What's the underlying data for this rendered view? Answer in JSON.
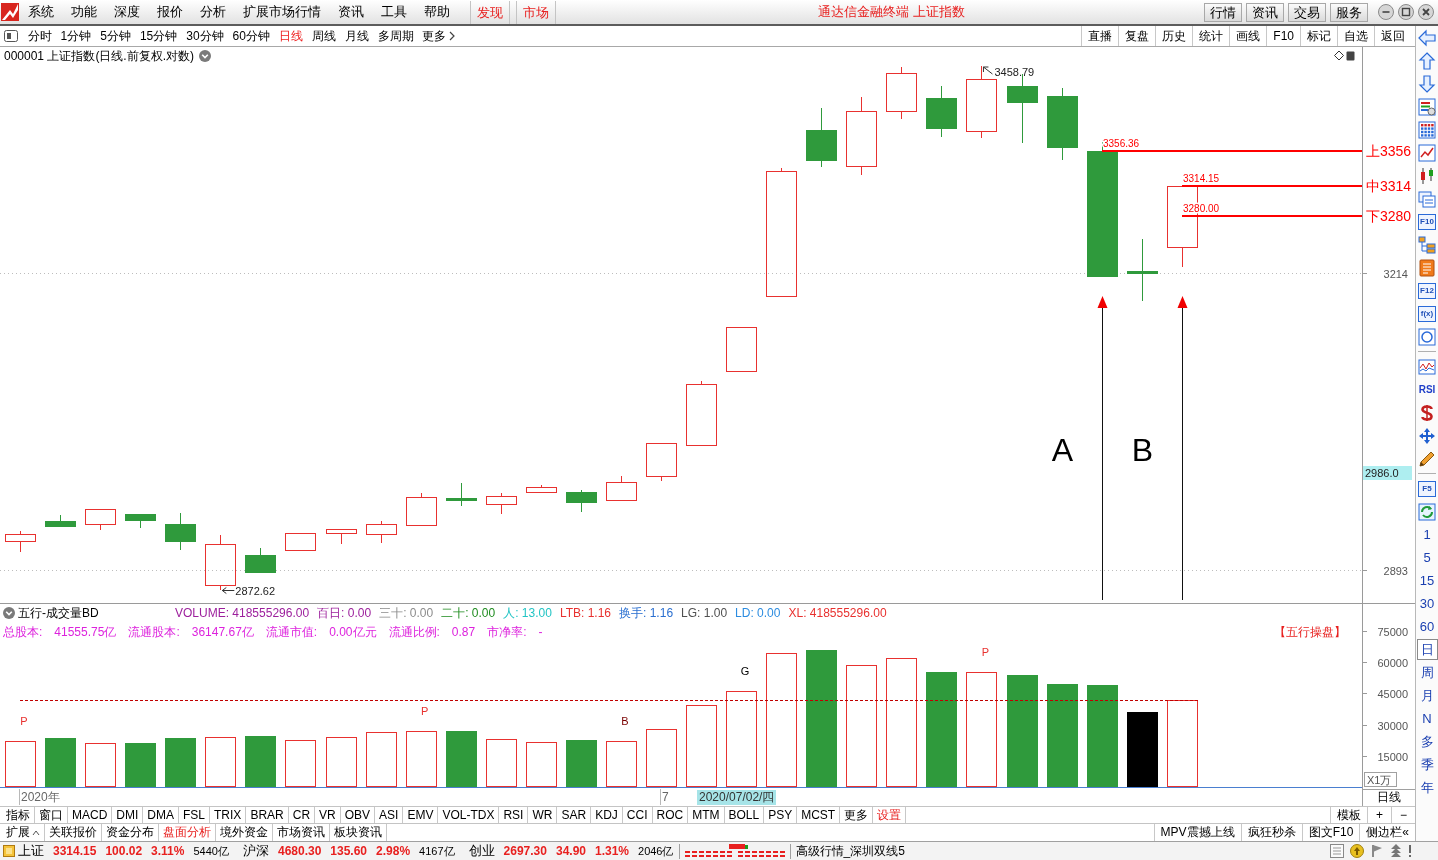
{
  "menu_bar": {
    "items": [
      "系统",
      "功能",
      "深度",
      "报价",
      "分析",
      "扩展市场行情",
      "资讯",
      "工具",
      "帮助"
    ],
    "tabs": [
      "发现",
      "市场"
    ],
    "title": "通达信金融终端 上证指数",
    "buttons": [
      "行情",
      "资讯",
      "交易",
      "服务"
    ]
  },
  "period_bar": {
    "periods": [
      {
        "label": "分时",
        "selected": false
      },
      {
        "label": "1分钟",
        "selected": false
      },
      {
        "label": "5分钟",
        "selected": false
      },
      {
        "label": "15分钟",
        "selected": false
      },
      {
        "label": "30分钟",
        "selected": false
      },
      {
        "label": "60分钟",
        "selected": false
      },
      {
        "label": "日线",
        "selected": true
      },
      {
        "label": "周线",
        "selected": false
      },
      {
        "label": "月线",
        "selected": false
      },
      {
        "label": "多周期",
        "selected": false
      }
    ],
    "more": "更多",
    "tools": [
      "直播",
      "复盘",
      "历史",
      "统计",
      "画线",
      "F10",
      "标记",
      "自选",
      "返回"
    ]
  },
  "price_pane": {
    "title": "000001 上证指数(日线.前复权.对数)",
    "high_label": "3458.79",
    "low_label": "2872.62",
    "level_values": [
      "3356.36",
      "3314.15",
      "3280.00"
    ],
    "arrow_labels": [
      "A",
      "B"
    ],
    "readout": "2986.0",
    "chart_data": [
      {
        "type": "candlestick",
        "log": true,
        "ylim": [
          2859.3,
          3482.0
        ],
        "yticks": [
          2893,
          3214
        ],
        "tick_labels": "y",
        "grid": true,
        "ohlc": [
          [
            2922.9,
            2933.3,
            2911.5,
            2930.2
          ],
          [
            2943.7,
            2949.9,
            2936.4,
            2938.5
          ],
          [
            2940.6,
            2956.2,
            2934.3,
            2956.2
          ],
          [
            2950.9,
            2950.9,
            2936.4,
            2944.7
          ],
          [
            2940.6,
            2951.9,
            2913.5,
            2922.9
          ],
          [
            2877.6,
            2929.1,
            2872.62,
            2919.7
          ],
          [
            2908.4,
            2915.6,
            2891.0,
            2891.0
          ],
          [
            2913.5,
            2931.2,
            2911.5,
            2931.2
          ],
          [
            2931.2,
            2936.4,
            2919.7,
            2935.4
          ],
          [
            2930.2,
            2943.7,
            2920.8,
            2940.6
          ],
          [
            2939.5,
            2972.9,
            2937.4,
            2968.7
          ],
          [
            2967.7,
            2983.5,
            2959.3,
            2965.6
          ],
          [
            2961.4,
            2972.9,
            2950.9,
            2969.8
          ],
          [
            2974.0,
            2981.4,
            2971.9,
            2979.3
          ],
          [
            2974.0,
            2976.1,
            2953.0,
            2963.5
          ],
          [
            2965.6,
            2990.9,
            2965.6,
            2984.6
          ],
          [
            2990.9,
            3026.1,
            2985.6,
            3025.98
          ],
          [
            3024.0,
            3093.4,
            3021.9,
            3090.57
          ],
          [
            3104.4,
            3153.1,
            3103.3,
            3152.81
          ],
          [
            3188.0,
            3335.8,
            3188.0,
            3332.88
          ],
          [
            3381.1,
            3407.5,
            3337.0,
            3345.34
          ],
          [
            3338.2,
            3420.8,
            3327.6,
            3403.44
          ],
          [
            3403.9,
            3457.4,
            3394.3,
            3450.59
          ],
          [
            3419.6,
            3434.2,
            3372.7,
            3383.32
          ],
          [
            3379.9,
            3458.79,
            3371.5,
            3443.29
          ],
          [
            3434.2,
            3448.8,
            3365.5,
            3414.62
          ],
          [
            3422.0,
            3431.8,
            3345.3,
            3361.3
          ],
          [
            3356.36,
            3369.1,
            3210.1,
            3210.1
          ],
          [
            3216.3,
            3253.0,
            3182.3,
            3214.13
          ],
          [
            3243.7,
            3314.15,
            3220.8,
            3314.15
          ],
          null,
          null,
          null,
          null
        ],
        "ref_lines": [
          {
            "axis": "y",
            "value": 3356.36,
            "label": "上3356",
            "color": "#ff0000"
          },
          {
            "axis": "y",
            "value": 3314.15,
            "label": "中3314",
            "color": "#ff0000"
          },
          {
            "axis": "y",
            "value": 3280.0,
            "label": "下3280",
            "color": "#ff0000"
          }
        ]
      }
    ]
  },
  "volume_pane": {
    "title": "五行-成交量BD",
    "readouts": [
      {
        "text": "VOLUME: 418555296.00",
        "color": "#9c1f9c"
      },
      {
        "text": "百日: 0.00",
        "color": "#9c1f9c"
      },
      {
        "text": "三十: 0.00",
        "color": "#8c8c8c"
      },
      {
        "text": "二十: 0.00",
        "color": "#1f8c1f"
      },
      {
        "text": "人: 13.00",
        "color": "#22c4c4"
      },
      {
        "text": "LTB: 1.16",
        "color": "#e8312f"
      },
      {
        "text": "换手: 1.16",
        "color": "#2a6fd0"
      },
      {
        "text": "LG: 1.00",
        "color": "#505050"
      },
      {
        "text": "LD: 0.00",
        "color": "#2c8ce0"
      },
      {
        "text": "XL: 418555296.00",
        "color": "#e8312f"
      }
    ],
    "stats": [
      {
        "name": "总股本:",
        "value": "41555.75亿"
      },
      {
        "name": "流通股本:",
        "value": "36147.67亿"
      },
      {
        "name": "流通市值:",
        "value": "0.00亿元"
      },
      {
        "name": "流通比例:",
        "value": "0.87"
      },
      {
        "name": "市净率:",
        "value": "-"
      }
    ],
    "badge": "【五行操盘】",
    "signals": [
      {
        "label": "P",
        "color": "#e8312f"
      },
      {
        "label": "P",
        "color": "#e8312f"
      },
      {
        "label": "B",
        "color": "#7a0000"
      },
      {
        "label": "G",
        "color": "#000000"
      },
      {
        "label": "P",
        "color": "#e8312f"
      }
    ],
    "chart_data": [
      {
        "type": "bar",
        "ylim": [
          0,
          88000
        ],
        "yticks": [
          15000,
          30000,
          45000,
          60000,
          75000
        ],
        "ylabel": "X1万",
        "values": [
          22000,
          23500,
          21000,
          21000,
          23500,
          24000,
          24500,
          22500,
          24000,
          26500,
          27000,
          27000,
          23000,
          21500,
          22500,
          22000,
          28000,
          39500,
          46000,
          64500,
          66000,
          58500,
          62000,
          55500,
          55500,
          54000,
          49500,
          49000,
          36000,
          42000,
          null,
          null,
          null,
          null
        ],
        "colors": [
          "#e8312f",
          "#2f9a3c",
          "#e8312f",
          "#2f9a3c",
          "#2f9a3c",
          "#e8312f",
          "#2f9a3c",
          "#e8312f",
          "#e8312f",
          "#e8312f",
          "#e8312f",
          "#2f9a3c",
          "#e8312f",
          "#e8312f",
          "#2f9a3c",
          "#e8312f",
          "#e8312f",
          "#e8312f",
          "#e8312f",
          "#e8312f",
          "#2f9a3c",
          "#e8312f",
          "#e8312f",
          "#2f9a3c",
          "#e8312f",
          "#2f9a3c",
          "#2f9a3c",
          "#2f9a3c",
          "#000000",
          "#e8312f",
          null,
          null,
          null,
          null
        ],
        "ref_lines": [
          {
            "axis": "y",
            "value": 42000,
            "color": "#c00000",
            "line_style": "dashed"
          }
        ]
      }
    ]
  },
  "date_axis": {
    "labels": [
      "2020年",
      "7"
    ],
    "cursor": "2020/07/02/四",
    "period": "日线"
  },
  "indicator_bar": {
    "items": [
      "指标",
      "窗口",
      "MACD",
      "DMI",
      "DMA",
      "FSL",
      "TRIX",
      "BRAR",
      "CR",
      "VR",
      "OBV",
      "ASI",
      "EMV",
      "VOL-TDX",
      "RSI",
      "WR",
      "SAR",
      "KDJ",
      "CCI",
      "ROC",
      "MTM",
      "BOLL",
      "PSY",
      "MCST",
      "更多"
    ],
    "settings": "设置",
    "buttons": [
      "模板",
      "+",
      "−"
    ]
  },
  "info_bar": {
    "expand": {
      "label": "扩展",
      "expanded": true
    },
    "tabs": [
      {
        "label": "关联报价",
        "selected": false
      },
      {
        "label": "资金分布",
        "selected": false
      },
      {
        "label": "盘面分析",
        "selected": true
      },
      {
        "label": "境外资金",
        "selected": false
      },
      {
        "label": "市场资讯",
        "selected": false
      },
      {
        "label": "板块资讯",
        "selected": false
      }
    ],
    "links": [
      "MPV震撼上线",
      "疯狂秒杀",
      "图文F10",
      "侧边栏«"
    ]
  },
  "side_toolbar": {
    "labels": [
      "F10",
      "F12",
      "f(x)",
      "RSI",
      "F5"
    ],
    "periods": [
      {
        "label": "1",
        "selected": false
      },
      {
        "label": "5",
        "selected": false
      },
      {
        "label": "15",
        "selected": false
      },
      {
        "label": "30",
        "selected": false
      },
      {
        "label": "60",
        "selected": false
      },
      {
        "label": "日",
        "selected": true
      },
      {
        "label": "周",
        "selected": false
      },
      {
        "label": "月",
        "selected": false
      },
      {
        "label": "N",
        "selected": false
      },
      {
        "label": "多",
        "selected": false
      },
      {
        "label": "季",
        "selected": false
      },
      {
        "label": "年",
        "selected": false
      }
    ]
  },
  "status_bar": {
    "indices": [
      {
        "name": "上证",
        "price": "3314.15",
        "change": "100.02",
        "percent": "3.11%",
        "turnover": "5440亿",
        "rising": true
      },
      {
        "name": "沪深",
        "price": "4680.30",
        "change": "135.60",
        "percent": "2.98%",
        "turnover": "4167亿",
        "rising": true
      },
      {
        "name": "创业",
        "price": "2697.30",
        "change": "34.90",
        "percent": "1.31%",
        "turnover": "2046亿",
        "rising": true
      }
    ],
    "feed": "高级行情_深圳双线5"
  }
}
